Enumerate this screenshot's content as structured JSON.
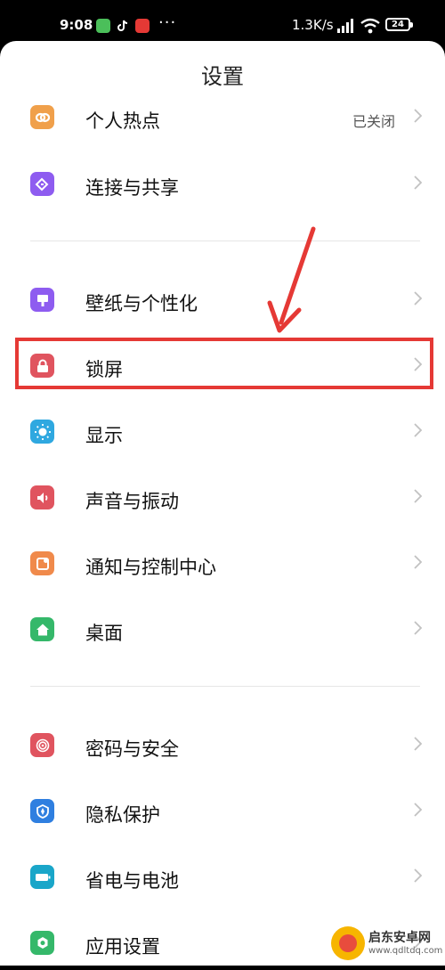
{
  "status_bar": {
    "time": "9:08",
    "network_speed": "1.3K/s",
    "battery": "24",
    "icons": [
      "wechat-app-icon",
      "tiktok-app-icon",
      "toutiao-app-icon"
    ]
  },
  "page": {
    "title": "设置"
  },
  "groups": [
    {
      "items": [
        {
          "label": "个人热点",
          "value": "已关闭",
          "icon": "hotspot-icon",
          "color": "#f0a04b"
        },
        {
          "label": "连接与共享",
          "icon": "connection-share-icon",
          "color": "#8e5cf0"
        }
      ]
    },
    {
      "items": [
        {
          "label": "壁纸与个性化",
          "icon": "wallpaper-icon",
          "color": "#8e5cf0"
        },
        {
          "label": "锁屏",
          "icon": "lock-icon",
          "color": "#e0545f"
        },
        {
          "label": "显示",
          "icon": "brightness-icon",
          "color": "#2fa8e0"
        },
        {
          "label": "声音与振动",
          "icon": "speaker-icon",
          "color": "#e0545f"
        },
        {
          "label": "通知与控制中心",
          "icon": "notification-icon",
          "color": "#f08a4b"
        },
        {
          "label": "桌面",
          "icon": "home-icon",
          "color": "#35b86a"
        }
      ]
    },
    {
      "items": [
        {
          "label": "密码与安全",
          "icon": "fingerprint-icon",
          "color": "#e0545f"
        },
        {
          "label": "隐私保护",
          "icon": "privacy-icon",
          "color": "#2f7fe0"
        },
        {
          "label": "省电与电池",
          "icon": "battery-icon",
          "color": "#1aa6c9"
        },
        {
          "label": "应用设置",
          "icon": "gear-icon",
          "color": "#35b86a"
        }
      ]
    }
  ],
  "annotation": {
    "color": "#e53935"
  },
  "watermark": {
    "text": "启东安卓网",
    "url": "www.qdltdq.com"
  }
}
